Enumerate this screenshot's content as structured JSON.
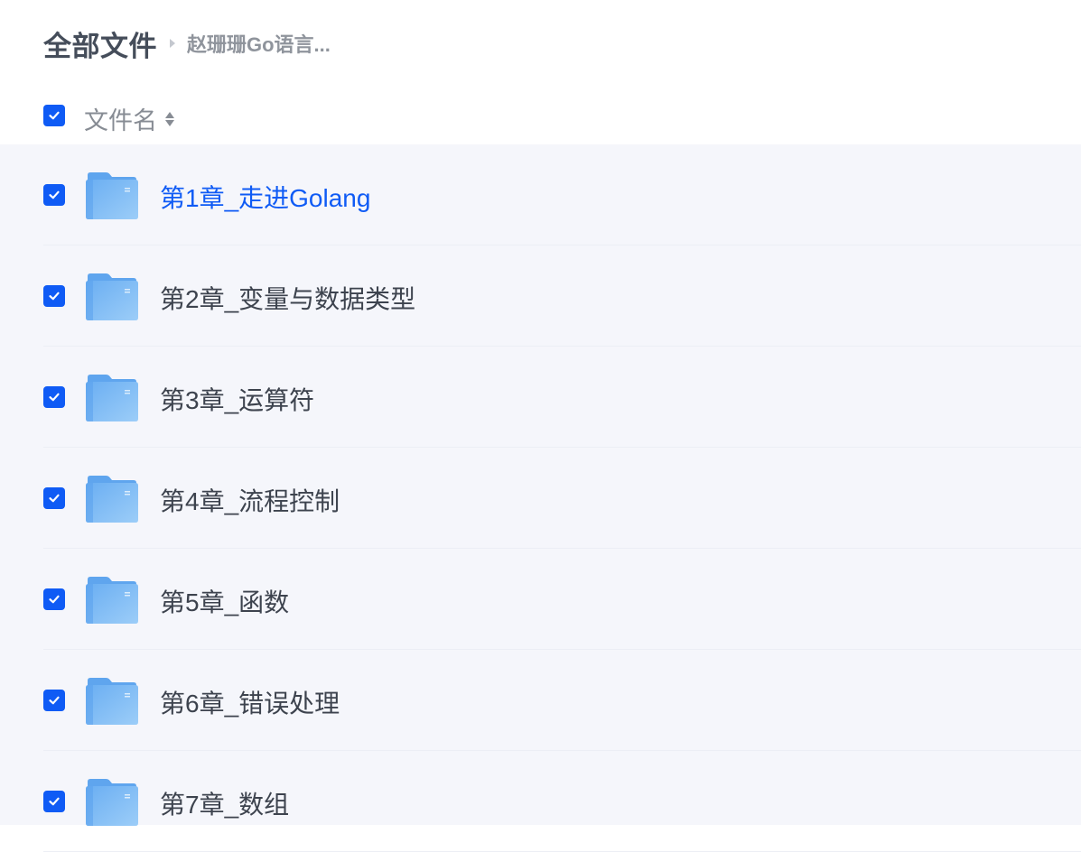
{
  "breadcrumb": {
    "root": "全部文件",
    "current": "赵珊珊Go语言..."
  },
  "header": {
    "select_all_checked": true,
    "column_name": "文件名",
    "sort_icon": "sort-icon"
  },
  "files": [
    {
      "name": "第1章_走进Golang",
      "checked": true,
      "active": true,
      "icon": "folder-icon"
    },
    {
      "name": "第2章_变量与数据类型",
      "checked": true,
      "active": false,
      "icon": "folder-icon"
    },
    {
      "name": "第3章_运算符",
      "checked": true,
      "active": false,
      "icon": "folder-icon"
    },
    {
      "name": "第4章_流程控制",
      "checked": true,
      "active": false,
      "icon": "folder-icon"
    },
    {
      "name": "第5章_函数",
      "checked": true,
      "active": false,
      "icon": "folder-icon"
    },
    {
      "name": "第6章_错误处理",
      "checked": true,
      "active": false,
      "icon": "folder-icon"
    },
    {
      "name": "第7章_数组",
      "checked": true,
      "active": false,
      "icon": "folder-icon"
    }
  ],
  "colors": {
    "accent": "#0f5bf5",
    "text": "#3d434e",
    "list_bg": "#f5f6fb",
    "folder": "#7cb9f4"
  }
}
